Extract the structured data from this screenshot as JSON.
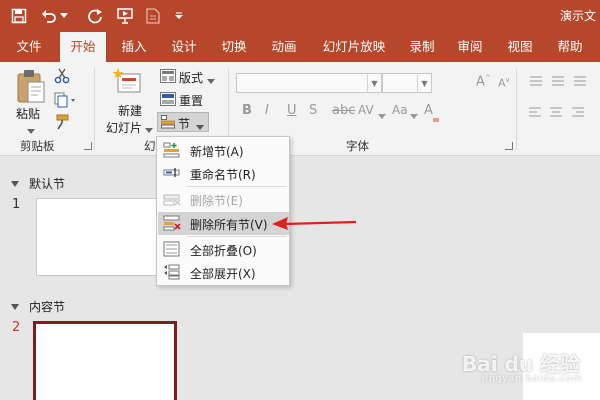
{
  "window": {
    "title": "演示文"
  },
  "colors": {
    "accent": "#b7472a",
    "ribbon_bg": "#f3f3f3",
    "arrow": "#e02020",
    "selected_border": "#7b1e1e"
  },
  "qat": {
    "icons": [
      "save-icon",
      "undo-icon",
      "undo-dropdown-icon",
      "redo-icon",
      "present-from-start-icon",
      "new-file-icon",
      "customize-qat-icon"
    ]
  },
  "tabs": [
    "文件",
    "开始",
    "插入",
    "设计",
    "切换",
    "动画",
    "幻灯片放映",
    "录制",
    "审阅",
    "视图",
    "帮助"
  ],
  "active_tab": "开始",
  "ribbon": {
    "clipboard": {
      "paste_label": "粘贴",
      "group_label": "剪贴板"
    },
    "slides": {
      "new_slide_label_line1": "新建",
      "new_slide_label_line2": "幻灯片",
      "layout_label": "版式",
      "reset_label": "重置",
      "section_label": "节",
      "group_label_visible": "幻"
    },
    "font": {
      "group_label": "字体",
      "bold": "B",
      "italic": "I",
      "underline": "U",
      "strike": "S",
      "spacing": "AV",
      "case": "Aa",
      "clear": "A"
    }
  },
  "section_menu": {
    "items": [
      {
        "label": "新增节(A)",
        "icon": "add-section-icon",
        "enabled": true
      },
      {
        "label": "重命名节(R)",
        "icon": "rename-section-icon",
        "enabled": true
      },
      {
        "label": "删除节(E)",
        "icon": "remove-section-icon",
        "enabled": false
      },
      {
        "label": "删除所有节(V)",
        "icon": "remove-all-sections-icon",
        "enabled": true,
        "highlighted": true
      },
      {
        "label": "全部折叠(O)",
        "icon": "collapse-all-icon",
        "enabled": true
      },
      {
        "label": "全部展开(X)",
        "icon": "expand-all-icon",
        "enabled": true
      }
    ]
  },
  "slides_panel": {
    "sections": [
      {
        "title": "默认节",
        "slides": [
          "1"
        ]
      },
      {
        "title": "内容节",
        "slides": [
          "2"
        ]
      }
    ],
    "selected_slide": "2"
  },
  "watermark": {
    "text": "Bai du 经验",
    "sub": "jingyan.baidu.com"
  }
}
